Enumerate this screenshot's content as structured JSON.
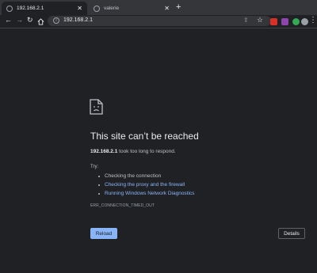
{
  "tabs": [
    {
      "title": "192.168.2.1",
      "active": true,
      "icon": "globe-icon"
    },
    {
      "title": "valerie",
      "active": false,
      "icon": "globe-icon"
    }
  ],
  "toolbar": {
    "url": "192.168.2.1",
    "back_icon": "←",
    "forward_icon": "→",
    "reload_icon": "↻",
    "new_tab_icon": "+",
    "extensions": [
      {
        "name": "red-extension-icon",
        "color": "#d93025"
      },
      {
        "name": "purple-extension-icon",
        "color": "#8e44ad"
      },
      {
        "name": "green-extension-icon",
        "color": "#34a853"
      },
      {
        "name": "profile-icon",
        "color": "#9aa0a6"
      }
    ]
  },
  "error": {
    "title": "This site can’t be reached",
    "host": "192.168.2.1",
    "summary_rest": " took too long to respond.",
    "try_label": "Try:",
    "suggestions": [
      {
        "text": "Checking the connection",
        "link": false
      },
      {
        "text": "Checking the proxy and the firewall",
        "link": true
      },
      {
        "text": "Running Windows Network Diagnostics",
        "link": true
      }
    ],
    "code": "ERR_CONNECTION_TIMED_OUT",
    "reload_label": "Reload",
    "details_label": "Details"
  },
  "colors": {
    "background": "#202124",
    "accent": "#8ab4f8",
    "text": "#bdc1c6"
  }
}
